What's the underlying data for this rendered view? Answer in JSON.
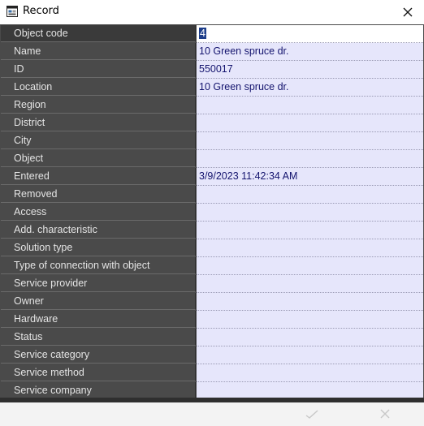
{
  "window": {
    "title": "Record",
    "close_icon": "close-icon",
    "app_icon": "record-app-icon"
  },
  "rows": [
    {
      "label": "Object code",
      "value": "4",
      "editing": true
    },
    {
      "label": "Name",
      "value": "10 Green spruce dr."
    },
    {
      "label": "ID",
      "value": "550017"
    },
    {
      "label": "Location",
      "value": "10 Green spruce dr."
    },
    {
      "label": "Region",
      "value": ""
    },
    {
      "label": "District",
      "value": ""
    },
    {
      "label": "City",
      "value": ""
    },
    {
      "label": "Object",
      "value": ""
    },
    {
      "label": "Entered",
      "value": "3/9/2023 11:42:34 AM"
    },
    {
      "label": "Removed",
      "value": ""
    },
    {
      "label": "Access",
      "value": ""
    },
    {
      "label": "Add. characteristic",
      "value": ""
    },
    {
      "label": "Solution type",
      "value": ""
    },
    {
      "label": "Type of connection with object",
      "value": ""
    },
    {
      "label": "Service provider",
      "value": ""
    },
    {
      "label": "Owner",
      "value": ""
    },
    {
      "label": "Hardware",
      "value": ""
    },
    {
      "label": "Status",
      "value": ""
    },
    {
      "label": "Service category",
      "value": ""
    },
    {
      "label": "Service method",
      "value": ""
    },
    {
      "label": "Service company",
      "value": ""
    }
  ],
  "footer": {
    "confirm_icon": "checkmark-icon",
    "cancel_icon": "cancel-icon"
  },
  "colors": {
    "label_bg": "#4a4a4a",
    "value_bg": "#e6e6fb",
    "value_text": "#14146e",
    "selection": "#1e3e8a"
  }
}
